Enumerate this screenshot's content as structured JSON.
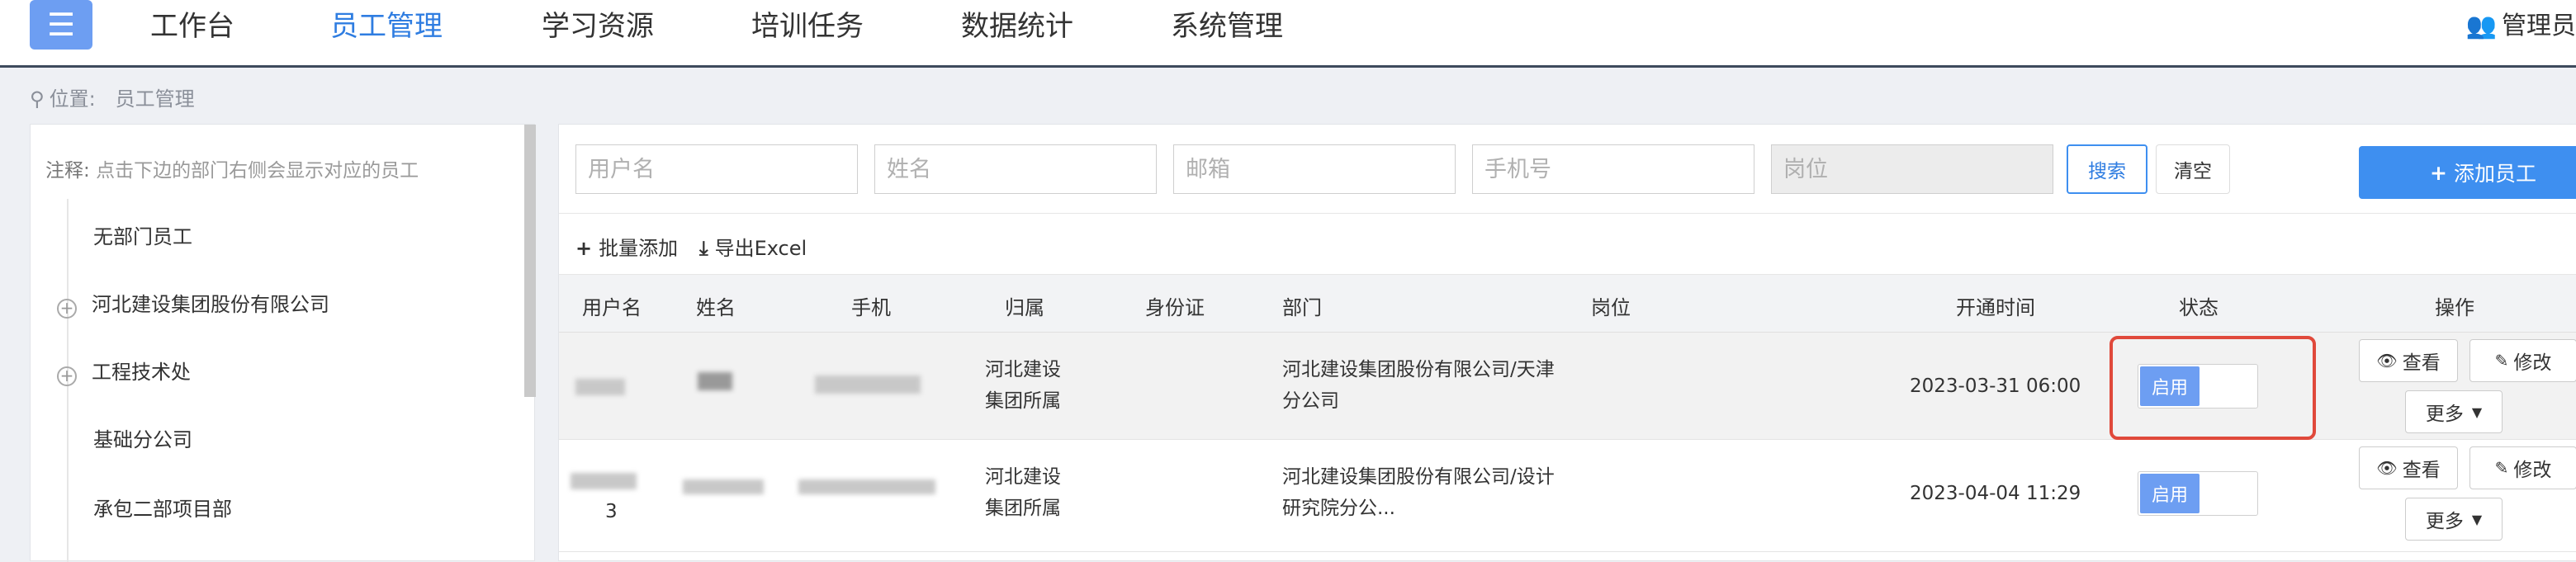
{
  "nav": {
    "items": [
      "工作台",
      "员工管理",
      "学习资源",
      "培训任务",
      "数据统计",
      "系统管理"
    ],
    "admin": "管理员"
  },
  "breadcrumb": {
    "prefix": "位置:",
    "current": "员工管理"
  },
  "dept_panel": {
    "note_key": "注释:",
    "note_text": "点击下边的部门右侧会显示对应的员工",
    "items": [
      "无部门员工",
      "河北建设集团股份有限公司",
      "工程技术处",
      "基础分公司",
      "承包二部项目部"
    ]
  },
  "search": {
    "username_placeholder": "用户名",
    "name_placeholder": "姓名",
    "email_placeholder": "邮箱",
    "phone_placeholder": "手机号",
    "position_placeholder": "岗位",
    "search_label": "搜索",
    "clear_label": "清空",
    "add_label": "添加员工"
  },
  "toolbar": {
    "batch_add": "批量添加",
    "export": "导出Excel"
  },
  "table": {
    "headers": [
      "用户名",
      "姓名",
      "手机",
      "归属",
      "身份证",
      "部门",
      "岗位",
      "开通时间",
      "状态",
      "操作"
    ],
    "rows": [
      {
        "belong_1": "河北建设",
        "belong_2": "集团所属",
        "dept_1": "河北建设集团股份有限公司/天津",
        "dept_2": "分公司",
        "time": "2023-03-31 06:00",
        "status": "启用"
      },
      {
        "username_suffix": "3",
        "belong_1": "河北建设",
        "belong_2": "集团所属",
        "dept_1": "河北建设集团股份有限公司/设计",
        "dept_2": "研究院分公...",
        "time": "2023-04-04 11:29",
        "status": "启用"
      }
    ],
    "actions": {
      "view": "查看",
      "edit": "修改",
      "more": "更多"
    }
  },
  "colors": {
    "primary": "#3e8ff0",
    "toggle_on": "#6d9ef2",
    "highlight": "#e0493b"
  },
  "icons": [
    "menu-icon",
    "users-icon",
    "location-pin-icon",
    "plus-circle-icon",
    "plus-icon",
    "download-icon",
    "eye-icon",
    "edit-icon",
    "caret-down-icon"
  ]
}
